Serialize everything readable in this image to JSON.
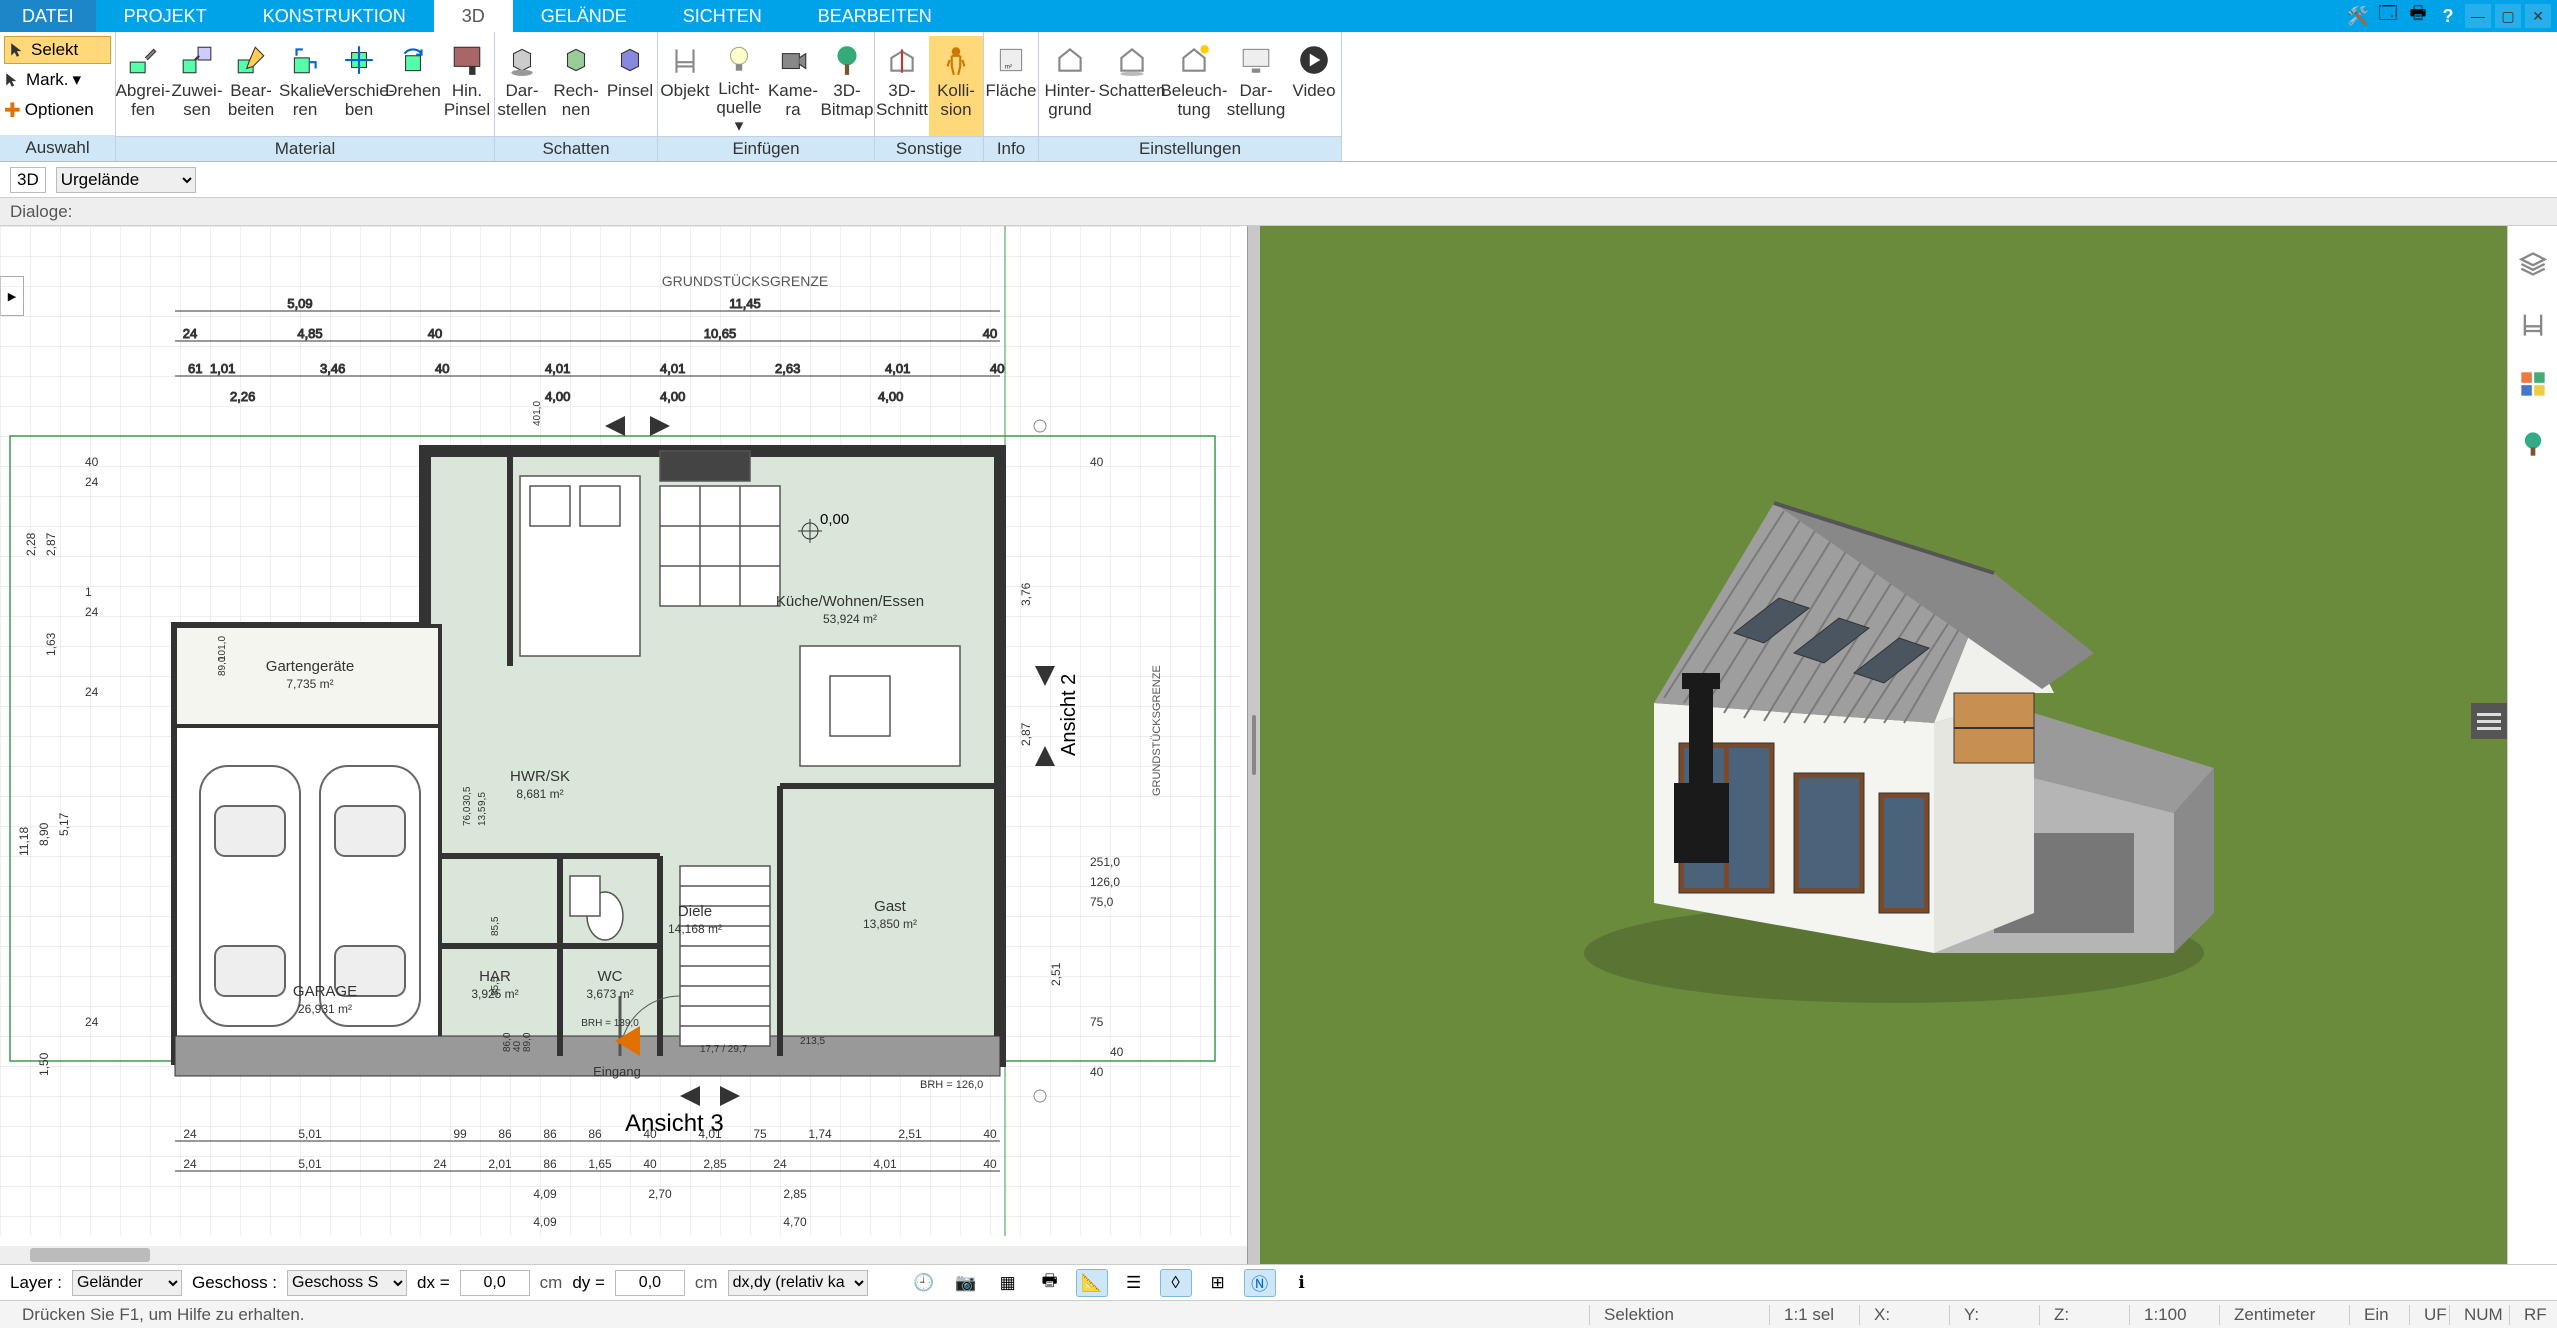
{
  "menu": {
    "tabs": [
      "DATEI",
      "PROJEKT",
      "KONSTRUKTION",
      "3D",
      "GELÄNDE",
      "SICHTEN",
      "BEARBEITEN"
    ],
    "active": "3D"
  },
  "ribbon": {
    "left": {
      "selekt": "Selekt",
      "mark": "Mark.",
      "optionen": "Optionen",
      "group_label": "Auswahl"
    },
    "groups": [
      {
        "label": "Material",
        "items": [
          {
            "id": "abgreifen",
            "label": "Abgrei-\nfen"
          },
          {
            "id": "zuweisen",
            "label": "Zuwei-\nsen"
          },
          {
            "id": "bearbeiten",
            "label": "Bear-\nbeiten"
          },
          {
            "id": "skalieren",
            "label": "Skalie-\nren"
          },
          {
            "id": "verschieben",
            "label": "Verschie-\nben"
          },
          {
            "id": "drehen",
            "label": "Drehen"
          },
          {
            "id": "hin-pinsel",
            "label": "Hin.\nPinsel"
          }
        ]
      },
      {
        "label": "Schatten",
        "items": [
          {
            "id": "darstellen",
            "label": "Dar-\nstellen"
          },
          {
            "id": "rechnen",
            "label": "Rech-\nnen"
          },
          {
            "id": "pinsel",
            "label": "Pinsel"
          }
        ]
      },
      {
        "label": "Einfügen",
        "items": [
          {
            "id": "objekt",
            "label": "Objekt"
          },
          {
            "id": "lichtquelle",
            "label": "Licht-\nquelle ▾"
          },
          {
            "id": "kamera",
            "label": "Kame-\nra"
          },
          {
            "id": "3d-bitmap",
            "label": "3D-\nBitmap"
          }
        ]
      },
      {
        "label": "Sonstige",
        "items": [
          {
            "id": "3d-schnitt",
            "label": "3D-\nSchnitt"
          },
          {
            "id": "kollision",
            "label": "Kolli-\nsion",
            "active": true
          }
        ]
      },
      {
        "label": "Info",
        "items": [
          {
            "id": "flaeche",
            "label": "Fläche"
          }
        ]
      },
      {
        "label": "Einstellungen",
        "items": [
          {
            "id": "hintergrund",
            "label": "Hinter-\ngrund"
          },
          {
            "id": "schatten2",
            "label": "Schatten"
          },
          {
            "id": "beleuchtung",
            "label": "Beleuch-\ntung"
          },
          {
            "id": "darstellung",
            "label": "Dar-\nstellung"
          },
          {
            "id": "video",
            "label": "Video"
          }
        ]
      }
    ]
  },
  "subbar": {
    "view_mode": "3D",
    "terrain": "Urgelände"
  },
  "dialog_row": {
    "label": "Dialoge:"
  },
  "plan": {
    "title_top": "GRUNDSTÜCKSGRENZE",
    "title_right": "GRUNDSTÜCKSGRENZE",
    "ansicht2": "Ansicht 2",
    "ansicht3": "Ansicht 3",
    "eingang": "Eingang",
    "brh_right": "BRH = 126,0",
    "brh_bottom": "BRH = 126,0",
    "dims_top1": [
      "5,09",
      "11,45"
    ],
    "dims_top2_left": [
      "24",
      "4,85",
      "40"
    ],
    "dims_top2_right": [
      "10,65",
      "40"
    ],
    "dims_top3": [
      "61",
      "1,01",
      "3,46",
      "40",
      "4,01",
      "4,01",
      "2,63",
      "4,01",
      "40"
    ],
    "dims_top4": [
      "2,26",
      "4,00",
      "4,00",
      "4,00"
    ],
    "dim_origin": "0,00",
    "dims_left": [
      "40",
      "24",
      "2,28",
      "2,87",
      "1",
      "24",
      "1,63",
      "24",
      "11,18",
      "8,90",
      "5,17",
      "24",
      "1,50"
    ],
    "dims_right_group": [
      "40",
      "3,76",
      "2,87",
      "251,0",
      "126,0",
      "75,0",
      "2,51",
      "75",
      "40",
      "40"
    ],
    "dims_bottom1": [
      "24",
      "5,01",
      "99",
      "86",
      "86",
      "86",
      "40",
      "4,01",
      "75",
      "1,74",
      "2,51",
      "40"
    ],
    "dims_bottom2": [
      "24",
      "5,01",
      "24",
      "2,01",
      "86",
      "1,65",
      "40",
      "2,85",
      "24",
      "4,01",
      "40"
    ],
    "dims_bottom3": [
      "4,09",
      "2,70",
      "2,85"
    ],
    "dims_bottom4": [
      "4,09",
      "4,70"
    ],
    "dims_misc": [
      "401,0",
      "101,0",
      "89,0",
      "30,5",
      "76,0",
      "9,5",
      "13,5",
      "85,5",
      "85,5",
      "17,7 / 29,7",
      "213,5",
      "86,0",
      "40",
      "89,0"
    ],
    "rooms": {
      "garage": {
        "name": "GARAGE",
        "area": "26,931 m²"
      },
      "gartengeraete": {
        "name": "Gartengeräte",
        "area": "7,735 m²"
      },
      "hwr": {
        "name": "HWR/SK",
        "area": "8,681 m²"
      },
      "har": {
        "name": "HAR",
        "area": "3,925 m²"
      },
      "wc": {
        "name": "WC",
        "area": "3,673 m²",
        "brh": "BRH = 139,0"
      },
      "diele": {
        "name": "Diele",
        "area": "14,168 m²"
      },
      "kueche": {
        "name": "Küche/Wohnen/Essen",
        "area": "53,924 m²"
      },
      "gast": {
        "name": "Gast",
        "area": "13,850 m²"
      }
    }
  },
  "bottombar": {
    "layer_label": "Layer :",
    "layer_value": "Geländer",
    "geschoss_label": "Geschoss :",
    "geschoss_value": "Geschoss S",
    "dx_label": "dx =",
    "dx_value": "0,0",
    "dy_label": "dy =",
    "dy_value": "0,0",
    "unit": "cm",
    "relative": "dx,dy (relativ ka"
  },
  "statusbar": {
    "help": "Drücken Sie F1, um Hilfe zu erhalten.",
    "mode": "Selektion",
    "sel": "1:1 sel",
    "x": "X:",
    "y": "Y:",
    "z": "Z:",
    "scale": "1:100",
    "unit": "Zentimeter",
    "ein": "Ein",
    "uf": "UF",
    "num": "NUM",
    "rf": "RF"
  }
}
